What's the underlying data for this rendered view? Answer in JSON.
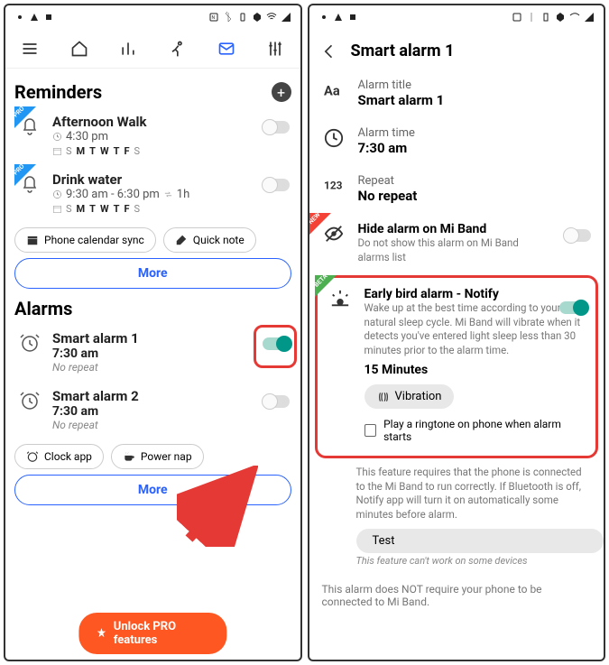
{
  "left": {
    "reminders_header": "Reminders",
    "reminders": [
      {
        "title": "Afternoon Walk",
        "time_text": "4:30 pm",
        "repeat_text": "",
        "days": [
          "S",
          "M",
          "T",
          "W",
          "T",
          "F",
          "S"
        ],
        "days_on": [
          false,
          true,
          true,
          true,
          true,
          true,
          false
        ],
        "enabled": false,
        "ribbon": "PRO"
      },
      {
        "title": "Drink water",
        "time_text": "9:30 am - 6:30 pm",
        "repeat_text": "1h",
        "days": [
          "S",
          "M",
          "T",
          "W",
          "T",
          "F",
          "S"
        ],
        "days_on": [
          false,
          true,
          true,
          true,
          true,
          true,
          false
        ],
        "enabled": false,
        "ribbon": "PRO"
      }
    ],
    "calendar_sync_label": "Phone calendar sync",
    "quick_note_label": "Quick note",
    "more_label": "More",
    "alarms_header": "Alarms",
    "alarms": [
      {
        "title": "Smart alarm 1",
        "time": "7:30 am",
        "repeat": "No repeat",
        "enabled": true
      },
      {
        "title": "Smart alarm 2",
        "time": "7:30 am",
        "repeat": "No repeat",
        "enabled": false
      }
    ],
    "clock_app_label": "Clock app",
    "power_nap_label": "Power nap",
    "unlock_pro_label": "Unlock PRO features"
  },
  "right": {
    "header_title": "Smart alarm 1",
    "rows": {
      "title_label": "Alarm title",
      "title_value": "Smart alarm 1",
      "time_label": "Alarm time",
      "time_value": "7:30 am",
      "repeat_label": "Repeat",
      "repeat_value": "No repeat",
      "hide_label": "Hide alarm on Mi Band",
      "hide_desc": "Do not show this alarm on Mi Band alarms list",
      "hide_enabled": false
    },
    "early": {
      "ribbon": "BETA",
      "title": "Early bird alarm - Notify",
      "desc": "Wake up at the best time according to your natural sleep cycle. Mi Band will vibrate when it detects you've entered light sleep less than 30 minutes prior to the alarm time.",
      "minutes": "15 Minutes",
      "vibration_label": "Vibration",
      "ringtone_label": "Play a ringtone on phone when alarm starts",
      "enabled": true
    },
    "note1": "This feature requires that the phone is connected to the Mi Band to run correctly. If Bluetooth is off, Notify app will turn it on automatically some minutes before alarm.",
    "test_label": "Test",
    "italic_note": "This feature can't work on some devices",
    "bottom_note": "This alarm does NOT require your phone to be connected to Mi Band."
  }
}
